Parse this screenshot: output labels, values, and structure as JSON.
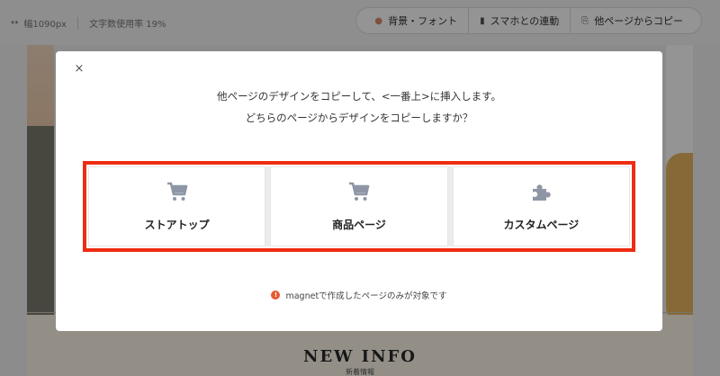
{
  "toolbar": {
    "width_label": "幅1090px",
    "text_usage": "文字数使用率 19%",
    "buttons": [
      {
        "label": "背景・フォント",
        "icon": "drop-icon"
      },
      {
        "label": "スマホとの連動",
        "icon": "phone-icon"
      },
      {
        "label": "他ページからコピー",
        "icon": "copy-page-icon"
      }
    ]
  },
  "background": {
    "news_title": "NEW INFO",
    "news_sub": "新着情報"
  },
  "modal": {
    "close_label": "×",
    "message_line1": "他ページのデザインをコピーして、<一番上>に挿入します。",
    "message_line2": "どちらのページからデザインをコピーしますか？",
    "options": [
      {
        "label": "ストアトップ",
        "icon": "cart-icon"
      },
      {
        "label": "商品ページ",
        "icon": "cart-icon"
      },
      {
        "label": "カスタムページ",
        "icon": "puzzle-icon"
      }
    ],
    "note": "magnetで作成したページのみが対象です",
    "note_icon": "!"
  },
  "colors": {
    "highlight": "#ee2c12",
    "icon_gray": "#8e96a6",
    "alert": "#e8592f"
  }
}
